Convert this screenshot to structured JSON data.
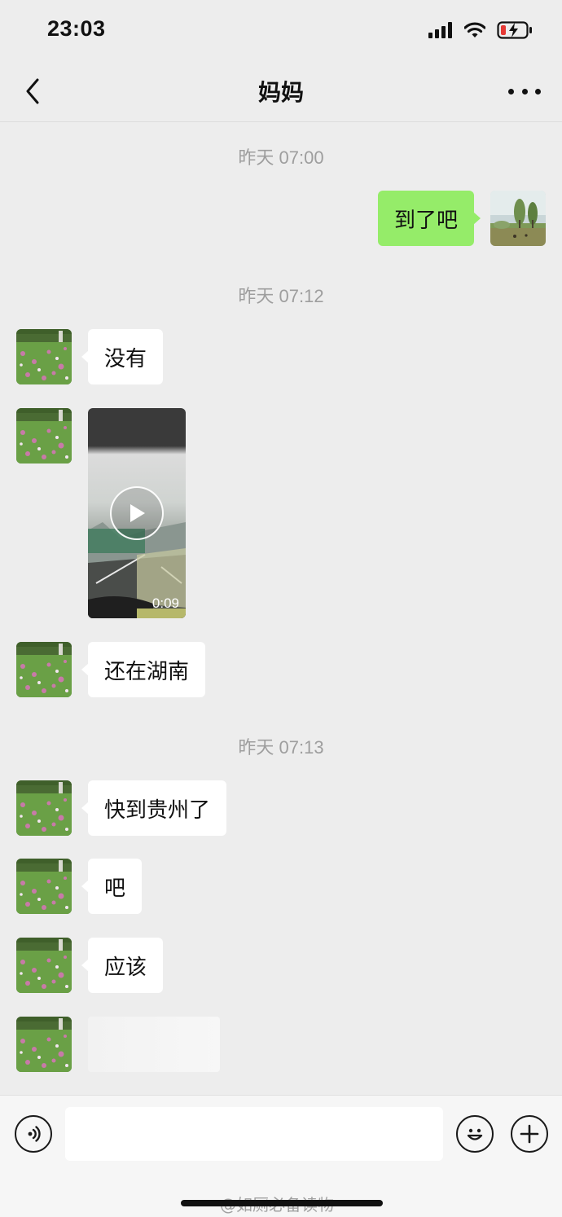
{
  "status_bar": {
    "time": "23:03"
  },
  "nav": {
    "title": "妈妈"
  },
  "messages": {
    "ts1": "昨天 07:00",
    "out1": "到了吧",
    "ts2": "昨天 07:12",
    "in1": "没有",
    "video_duration": "0:09",
    "in2": "还在湖南",
    "ts3": "昨天 07:13",
    "in3": "快到贵州了",
    "in4": "吧",
    "in5": "应该"
  },
  "input": {
    "placeholder": ""
  },
  "watermark": "@如厕必备读物",
  "colors": {
    "background": "#ededed",
    "outgoing_bubble": "#95ec69",
    "incoming_bubble": "#ffffff",
    "timestamp": "#9e9e9e"
  },
  "icons": [
    "back-chevron-icon",
    "more-dots-icon",
    "signal-icon",
    "wifi-icon",
    "battery-charging-icon",
    "play-icon",
    "voice-icon",
    "emoji-icon",
    "plus-icon"
  ]
}
